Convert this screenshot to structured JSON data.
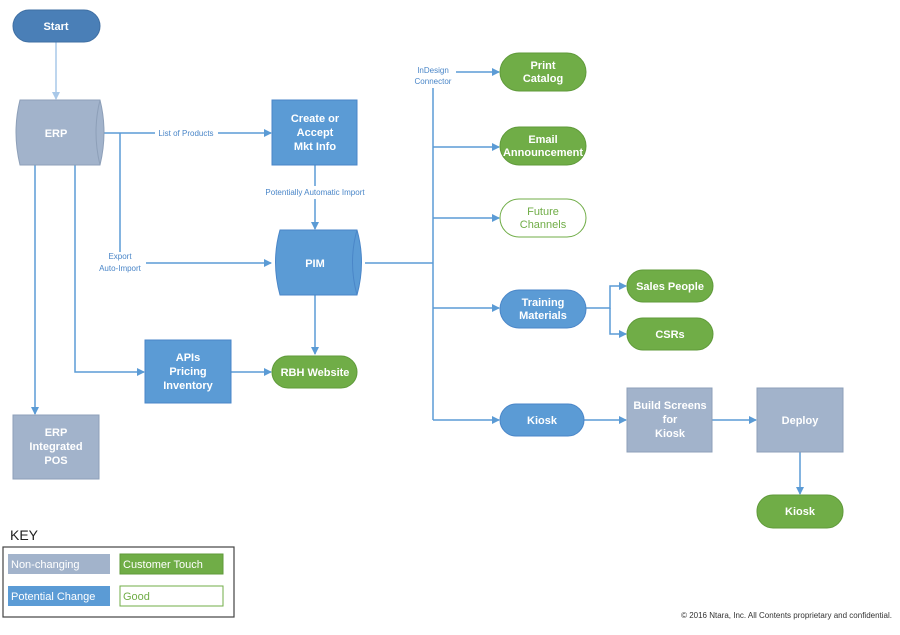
{
  "colors": {
    "non_changing": "#a2b3cb",
    "potential_change": "#5b9bd5",
    "customer_touch": "#70ad47",
    "start": "#4a7fb7",
    "connector": "#5b9bd5"
  },
  "nodes": {
    "start": "Start",
    "erp": "ERP",
    "create": [
      "Create or",
      "Accept",
      "Mkt Info"
    ],
    "pim": "PIM",
    "apis": [
      "APIs",
      "Pricing",
      "Inventory"
    ],
    "rbh": "RBH Website",
    "pos": [
      "ERP",
      "Integrated",
      "POS"
    ],
    "print": [
      "Print",
      "Catalog"
    ],
    "email": [
      "Email",
      "Announcement"
    ],
    "future": [
      "Future",
      "Channels"
    ],
    "training": [
      "Training",
      "Materials"
    ],
    "sales": "Sales People",
    "csrs": "CSRs",
    "kiosk1": "Kiosk",
    "build": [
      "Build Screens",
      "for",
      "Kiosk"
    ],
    "deploy": "Deploy",
    "kiosk2": "Kiosk"
  },
  "edges": {
    "list_of_products": "List of Products",
    "potentially_auto": "Potentially Automatic Import",
    "export": [
      "Export",
      "Auto-Import"
    ],
    "indesign": [
      "InDesign",
      "Connector"
    ]
  },
  "key": {
    "title": "KEY",
    "non_changing": "Non-changing",
    "customer_touch": "Customer Touch",
    "potential_change": "Potential Change",
    "good": "Good"
  },
  "footer": "© 2016 Ntara, Inc. All Contents proprietary and confidential."
}
